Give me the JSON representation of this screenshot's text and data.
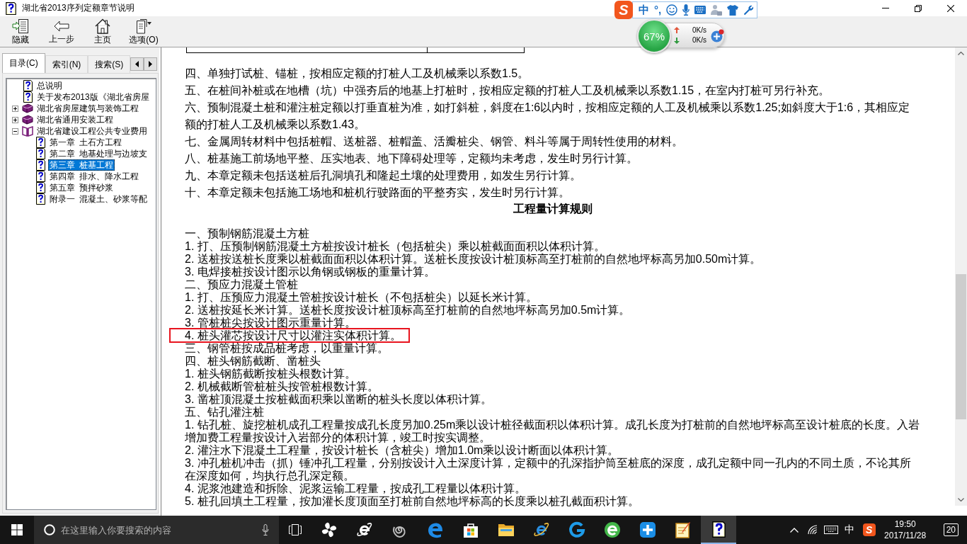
{
  "window": {
    "title": "湖北省2013序列定额章节说明"
  },
  "toolbar": [
    {
      "kind": "hide",
      "label": "隐藏"
    },
    {
      "kind": "back",
      "label": "上一步"
    },
    {
      "kind": "home",
      "label": "主页"
    },
    {
      "kind": "options",
      "label": "选项(O)"
    }
  ],
  "nav_tabs": [
    {
      "label": "目录(C)",
      "selected": true
    },
    {
      "label": "索引(N)",
      "selected": false
    },
    {
      "label": "搜索(S)",
      "selected": false
    }
  ],
  "tree": [
    {
      "kind": "topic",
      "label": "总说明",
      "selected": false
    },
    {
      "kind": "topic",
      "label": "关于发布2013版《湖北省房屋",
      "selected": false
    },
    {
      "kind": "book",
      "label": "湖北省房屋建筑与装饰工程",
      "expanded": false,
      "selected": false
    },
    {
      "kind": "book",
      "label": "湖北省通用安装工程",
      "expanded": false,
      "selected": false
    },
    {
      "kind": "book",
      "label": "湖北省建设工程公共专业费用",
      "expanded": true,
      "selected": false,
      "children": [
        {
          "kind": "topic",
          "label": "第一章 土石方工程",
          "selected": false
        },
        {
          "kind": "topic",
          "label": "第二章 地基处理与边坡支",
          "selected": false
        },
        {
          "kind": "topic",
          "label": "第三章 桩基工程",
          "selected": true
        },
        {
          "kind": "topic",
          "label": "第四章 排水、降水工程",
          "selected": false
        },
        {
          "kind": "topic",
          "label": "第五章 预拌砂浆",
          "selected": false
        },
        {
          "kind": "topic",
          "label": "附录一 混凝土、砂浆等配",
          "selected": false
        }
      ]
    }
  ],
  "document": {
    "notes": [
      "四、单独打试桩、锚桩，按相应定额的打桩人工及机械乘以系数1.5。",
      "五、在桩间补桩或在地槽（坑）中强夯后的地基上打桩时，按相应定额的打桩人工及机械乘以系数1.15，在室内打桩可另行补充。",
      "六、预制混凝土桩和灌注桩定额以打垂直桩为准，如打斜桩，斜度在1:6以内时，按相应定额的人工及机械乘以系数1.25;如斜度大于1:6，其相应定额的打桩人工及机械乘以系数1.43。",
      "七、金属周转材料中包括桩帽、送桩器、桩帽盖、活瓣桩尖、钢管、料斗等属于周转性使用的材料。",
      "八、桩基施工前场地平整、压实地表、地下障碍处理等，定额均未考虑，发生时另行计算。",
      "九、本章定额未包括送桩后孔洞填孔和隆起土壤的处理费用，如发生另行计算。",
      "十、本章定额未包括施工场地和桩机行驶路面的平整夯实，发生时另行计算。"
    ],
    "heading": "工程量计算规则",
    "rules": [
      {
        "text": "一、预制钢筋混凝土方桩",
        "highlighted": false
      },
      {
        "text": "1. 打、压预制钢筋混凝土方桩按设计桩长（包括桩尖）乘以桩截面面积以体积计算。",
        "highlighted": false
      },
      {
        "text": "2. 送桩按送桩长度乘以桩截面面积以体积计算。送桩长度按设计桩顶标高至打桩前的自然地坪标高另加0.50m计算。",
        "highlighted": false
      },
      {
        "text": "3. 电焊接桩按设计图示以角钢或钢板的重量计算。",
        "highlighted": false
      },
      {
        "text": "二、预应力混凝土管桩",
        "highlighted": false
      },
      {
        "text": "1. 打、压预应力混凝土管桩按设计桩长（不包括桩尖）以延长米计算。",
        "highlighted": false
      },
      {
        "text": "2. 送桩按延长米计算。送桩长度按设计桩顶标高至打桩前的自然地坪标高另加0.5m计算。",
        "highlighted": false
      },
      {
        "text": "3. 管桩桩尖按设计图示重量计算。",
        "highlighted": false
      },
      {
        "text": "4. 桩头灌芯按设计尺寸以灌注实体积计算。",
        "highlighted": true
      },
      {
        "text": "三、钢管桩按成品桩考虑，以重量计算。",
        "highlighted": false
      },
      {
        "text": "四、桩头钢筋截断、凿桩头",
        "highlighted": false
      },
      {
        "text": "1. 桩头钢筋截断按桩头根数计算。",
        "highlighted": false
      },
      {
        "text": "2. 机械截断管桩桩头按管桩根数计算。",
        "highlighted": false
      },
      {
        "text": "3. 凿桩顶混凝土按桩截面积乘以凿断的桩头长度以体积计算。",
        "highlighted": false
      },
      {
        "text": "五、钻孔灌注桩",
        "highlighted": false
      },
      {
        "text": "1. 钻孔桩、旋挖桩机成孔工程量按成孔长度另加0.25m乘以设计桩径截面积以体积计算。成孔长度为打桩前的自然地坪标高至设计桩底的长度。入岩增加费工程量按设计入岩部分的体积计算，竣工时按实调整。",
        "highlighted": false
      },
      {
        "text": "2. 灌注水下混凝土工程量，按设计桩长（含桩尖）增加1.0m乘以设计断面以体积计算。",
        "highlighted": false
      },
      {
        "text": "3. 冲孔桩机冲击（抓）锤冲孔工程量，分别按设计入土深度计算，定额中的孔深指护筒至桩底的深度，成孔定额中同一孔内的不同土质，不论其所在深度如何，均执行总孔深定额。",
        "highlighted": false
      },
      {
        "text": "4. 泥浆池建造和拆除、泥浆运输工程量，按成孔工程量以体积计算。",
        "highlighted": false
      },
      {
        "text": "5. 桩孔回填土工程量，按加灌长度顶面至打桩前自然地坪标高的长度乘以桩孔截面积计算。",
        "highlighted": false
      }
    ]
  },
  "ime_toolbar": {
    "logo": "S",
    "mode": "中",
    "punctuation": "°,"
  },
  "memory_widget": {
    "usage": "67%",
    "upload": "0K/s",
    "download": "0K/s"
  },
  "taskbar": {
    "search": {
      "placeholder": "在这里输入你要搜索的内容"
    },
    "apps": [
      {
        "kind": "pinwheel",
        "active": false
      },
      {
        "kind": "e-ring",
        "active": false
      },
      {
        "kind": "swirl",
        "active": false
      },
      {
        "kind": "e-edge",
        "active": false
      },
      {
        "kind": "store",
        "active": false
      },
      {
        "kind": "folder",
        "active": false
      },
      {
        "kind": "e-ie",
        "active": false
      },
      {
        "kind": "g",
        "active": false
      },
      {
        "kind": "e-green",
        "active": false
      },
      {
        "kind": "plus",
        "active": false
      },
      {
        "kind": "notepad",
        "active": false
      },
      {
        "kind": "help",
        "active": true
      }
    ],
    "tray": {
      "input_mode": "中",
      "ime_logo": "S",
      "time": "19:50",
      "date": "2017/11/28",
      "notifications": "20"
    }
  }
}
